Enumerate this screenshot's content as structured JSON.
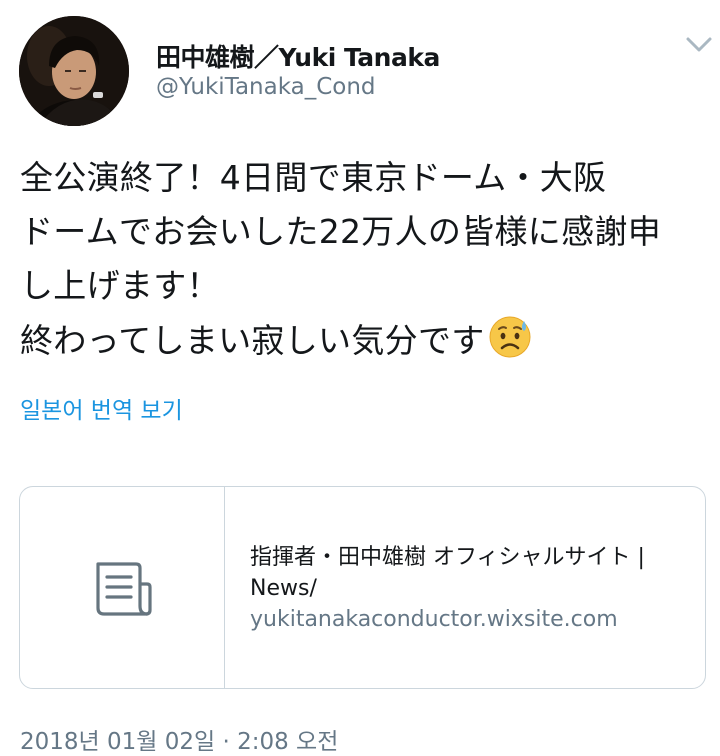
{
  "user": {
    "display_name": "田中雄樹／Yuki Tanaka",
    "handle": "@YukiTanaka_Cond",
    "avatar_icon": "profile-photo"
  },
  "tweet": {
    "lines": [
      "全公演終了！4日間で東京ドーム・大阪",
      "ドームでお会いした22万人の皆様に感謝申",
      "し上げます！",
      "終わってしまい寂しい気分です"
    ],
    "emoji": "sad-sweat-face-emoji"
  },
  "translate_link": "일본어 번역 보기",
  "link_card": {
    "icon": "document-icon",
    "title_line1": "指揮者・田中雄樹 オフィシャルサイト |",
    "title_line2": "News/",
    "domain": "yukitanakaconductor.wixsite.com"
  },
  "timestamp": "2018년 01월 02일 · 2:08 오전",
  "colors": {
    "text": "#14171a",
    "secondary": "#657786",
    "link": "#1b95e0",
    "border": "#ccd6dd"
  },
  "menu_icon": "chevron-down-icon"
}
